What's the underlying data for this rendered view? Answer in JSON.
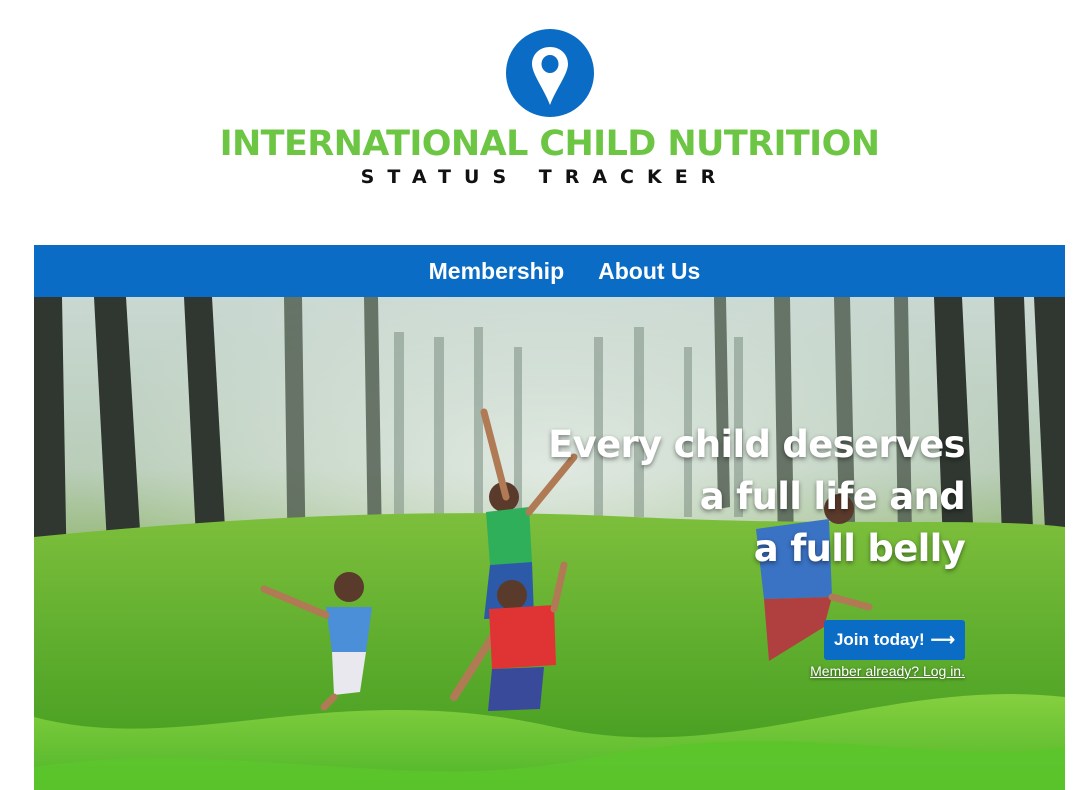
{
  "brand": {
    "title": "INTERNATIONAL CHILD NUTRITION",
    "subtitle": "STATUS TRACKER",
    "icon": "location-pin-icon",
    "colors": {
      "title_green": "#6cc644",
      "pin_blue": "#0a6cc4",
      "subtitle_black": "#111111"
    }
  },
  "nav": {
    "items": [
      {
        "label": "Membership"
      },
      {
        "label": "About Us"
      }
    ],
    "background": "#0a6cc4"
  },
  "hero": {
    "headline_lines": [
      "Every child deserves",
      "a full life and",
      "a full belly"
    ],
    "cta_label": "Join today!",
    "cta_icon": "arrow-right-icon",
    "login_text": "Member already? Log in.",
    "image": "children-jumping-in-forest-photo"
  }
}
